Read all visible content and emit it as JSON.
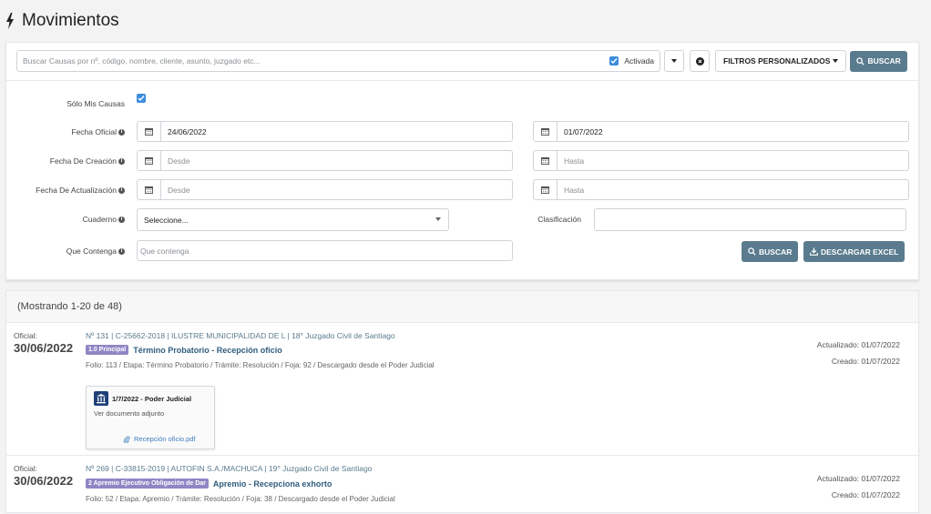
{
  "page": {
    "title": "Movimientos"
  },
  "search": {
    "placeholder": "Buscar Causas por nº, código, nombre, cliente, asunto, juzgado etc...",
    "activada_label": "Activada",
    "activada_checked": true,
    "filtros_label": "FILTROS PERSONALIZADOS",
    "buscar_label": "BUSCAR"
  },
  "filters": {
    "solo_mis_causas": {
      "label": "Sólo Mis Causas",
      "checked": true
    },
    "fecha_oficial": {
      "label": "Fecha Oficial",
      "from": "24/06/2022",
      "to": "01/07/2022"
    },
    "fecha_creacion": {
      "label": "Fecha De Creación",
      "from_placeholder": "Desde",
      "to_placeholder": "Hasta"
    },
    "fecha_actualizacion": {
      "label": "Fecha De Actualización",
      "from_placeholder": "Desde",
      "to_placeholder": "Hasta"
    },
    "cuaderno": {
      "label": "Cuaderno",
      "selected": "Seleccione..."
    },
    "clasificacion": {
      "label": "Clasificación",
      "value": ""
    },
    "que_contenga": {
      "label": "Que Contenga",
      "placeholder": "Que contenga"
    },
    "buscar_label": "BUSCAR",
    "excel_label": "DESCARGAR EXCEL"
  },
  "results": {
    "summary": "(Mostrando 1-20 de 48)",
    "items": [
      {
        "oficial_label": "Oficial:",
        "oficial_date": "30/06/2022",
        "meta": "Nº 131 | C-25662-2018 | ILUSTRE MUNICIPALIDAD DE L | 18° Juzgado Civil de Santiago",
        "badge": "1.0 Principal",
        "title": "Término Probatorio - Recepción oficio",
        "folio": "Folio: 113 / Etapa: Término Probatorio / Trámite: Resolución / Foja: 92 / Descargado desde el Poder Judicial",
        "actualizado": "Actualizado: 01/07/2022",
        "creado": "Creado: 01/07/2022",
        "doc": {
          "header": "1/7/2022 - Poder Judicial",
          "subtitle": "Ver documento adjunto",
          "file": "Recepción oficio.pdf"
        }
      },
      {
        "oficial_label": "Oficial:",
        "oficial_date": "30/06/2022",
        "meta": "Nº 269 | C-33815-2019 | AUTOFIN S.A./MACHUCA | 19° Juzgado Civil de Santiago",
        "badge": "2 Apremio Ejecutivo Obligación de Dar",
        "title": "Apremio - Recepciona exhorto",
        "folio": "Folio: 52 / Etapa: Apremio / Trámite: Resolución / Foja: 38 / Descargado desde el Poder Judicial",
        "actualizado": "Actualizado: 01/07/2022",
        "creado": "Creado: 01/07/2022"
      }
    ]
  },
  "colors": {
    "primary_button": "#5a7b8e",
    "badge": "#8f86c4",
    "checkbox": "#3c8dde",
    "title_link": "#2f5d7e"
  },
  "icons": [
    "bolt-icon",
    "calendar-icon",
    "info-icon",
    "search-icon",
    "download-icon",
    "paperclip-icon",
    "court-icon",
    "clear-icon",
    "caret-down-icon",
    "checkbox-icon"
  ]
}
